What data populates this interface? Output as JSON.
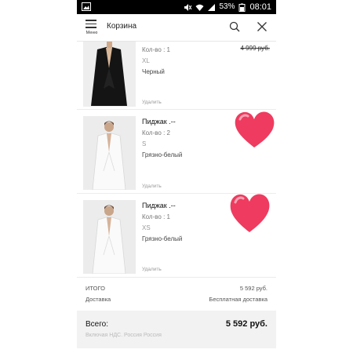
{
  "status_bar": {
    "battery": "53%",
    "time": "08:01"
  },
  "app_bar": {
    "menu_label": "Меню",
    "title": "Корзина",
    "icons": [
      "menu-icon",
      "search-icon",
      "close-icon"
    ]
  },
  "cart": {
    "items": [
      {
        "name": "",
        "quantity": "Кол-во : 1",
        "size": "XL",
        "color": "Черный",
        "old_price": "4 999 руб.",
        "remove": "Удалить",
        "photo": "black-blazer"
      },
      {
        "name": "Пиджак .--",
        "quantity": "Кол-во : 2",
        "size": "S",
        "color": "Грязно-белый",
        "old_price": "",
        "remove": "Удалить",
        "photo": "white-blazer"
      },
      {
        "name": "Пиджак .--",
        "quantity": "Кол-во : 1",
        "size": "XS",
        "color": "Грязно-белый",
        "old_price": "",
        "remove": "Удалить",
        "photo": "white-blazer"
      }
    ]
  },
  "totals": {
    "subtotal_label": "ИТОГО",
    "subtotal_value": "5 592 руб.",
    "delivery_label": "Доставка",
    "delivery_value": "Бесплатная доставка"
  },
  "summary": {
    "label": "Всего:",
    "value": "5 592 руб.",
    "note": "Включая НДС. Россия Россия"
  },
  "colors": {
    "status_bar": "#000000",
    "summary_bg": "#f2f2f2",
    "heart": "#ef3b5f"
  }
}
